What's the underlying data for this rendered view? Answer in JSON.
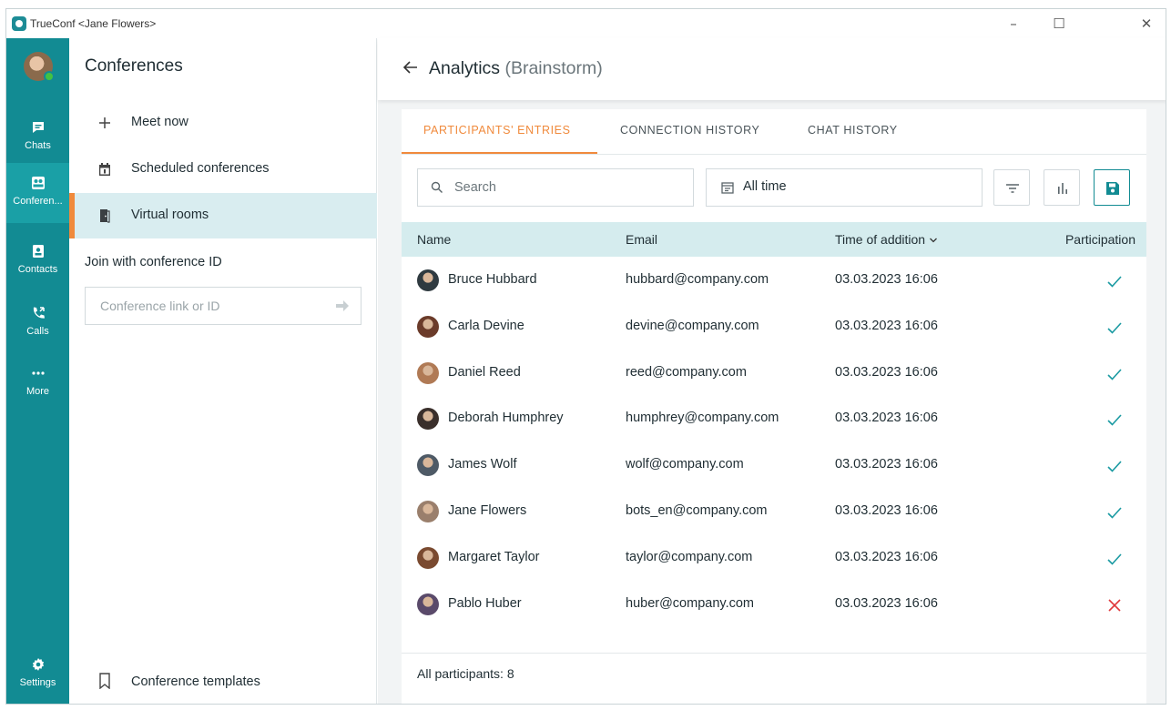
{
  "window": {
    "title": "TrueConf <Jane Flowers>",
    "min_symbol": "–",
    "max_symbol": "☐",
    "close_symbol": "✕"
  },
  "rail": {
    "items": [
      {
        "label": "Chats",
        "icon": "chat-icon"
      },
      {
        "label": "Conferen...",
        "icon": "conference-icon",
        "active": true
      },
      {
        "label": "Contacts",
        "icon": "contacts-icon"
      },
      {
        "label": "Calls",
        "icon": "calls-icon"
      },
      {
        "label": "More",
        "icon": "more-icon"
      },
      {
        "label": "Settings",
        "icon": "gear-icon"
      }
    ]
  },
  "conferences": {
    "title": "Conferences",
    "items": [
      {
        "label": "Meet now",
        "icon": "plus-icon"
      },
      {
        "label": "Scheduled conferences",
        "icon": "calendar-icon"
      },
      {
        "label": "Virtual rooms",
        "icon": "door-icon",
        "active": true
      }
    ],
    "join_label": "Join with conference ID",
    "join_placeholder": "Conference link or ID",
    "templates_label": "Conference templates"
  },
  "analytics": {
    "title": "Analytics",
    "subtitle": "(Brainstorm)",
    "tabs": [
      "PARTICIPANTS' ENTRIES",
      "CONNECTION HISTORY",
      "CHAT HISTORY"
    ],
    "active_tab": 0,
    "search_placeholder": "Search",
    "time_filter": "All time",
    "columns": {
      "name": "Name",
      "email": "Email",
      "time": "Time of addition",
      "participation": "Participation"
    },
    "rows": [
      {
        "name": "Bruce Hubbard",
        "email": "hubbard@company.com",
        "time": "03.03.2023 16:06",
        "participated": true
      },
      {
        "name": "Carla Devine",
        "email": "devine@company.com",
        "time": "03.03.2023 16:06",
        "participated": true
      },
      {
        "name": "Daniel Reed",
        "email": "reed@company.com",
        "time": "03.03.2023 16:06",
        "participated": true
      },
      {
        "name": "Deborah Humphrey",
        "email": "humphrey@company.com",
        "time": "03.03.2023 16:06",
        "participated": true
      },
      {
        "name": "James Wolf",
        "email": "wolf@company.com",
        "time": "03.03.2023 16:06",
        "participated": true
      },
      {
        "name": "Jane Flowers",
        "email": "bots_en@company.com",
        "time": "03.03.2023 16:06",
        "participated": true
      },
      {
        "name": "Margaret Taylor",
        "email": "taylor@company.com",
        "time": "03.03.2023 16:06",
        "participated": true
      },
      {
        "name": "Pablo Huber",
        "email": "huber@company.com",
        "time": "03.03.2023 16:06",
        "participated": false
      }
    ],
    "footer": "All participants: 8"
  },
  "colors": {
    "rail": "#128b93",
    "accent_orange": "#f08a3c",
    "check": "#1a9aa2",
    "cross": "#e0383b",
    "header_row": "#d5ecee"
  }
}
